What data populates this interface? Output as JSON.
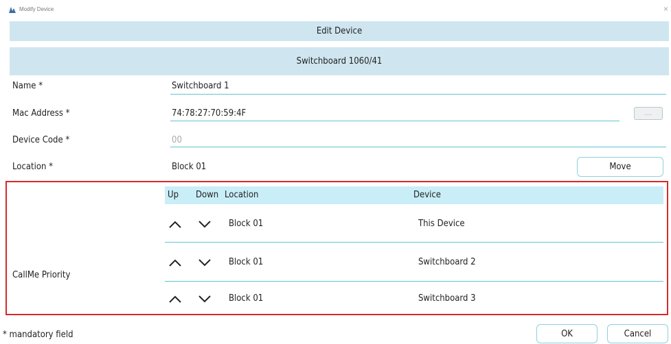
{
  "window": {
    "title": "Modify Device",
    "close_glyph": "×",
    "icon": "app-icon"
  },
  "header": {
    "title": "Edit Device"
  },
  "device": {
    "title": "Switchboard 1060/41"
  },
  "form": {
    "name_label": "Name *",
    "name_value": "Switchboard 1",
    "mac_label": "Mac Address *",
    "mac_value": "74:78:27:70:59:4F",
    "browse_label": "...",
    "code_label": "Device Code *",
    "code_placeholder": "00",
    "location_label": "Location *",
    "location_value": "Block 01",
    "move_label": "Move"
  },
  "priority": {
    "label": "CallMe Priority",
    "columns": {
      "up": "Up",
      "down": "Down",
      "location": "Location",
      "device": "Device"
    },
    "rows": [
      {
        "location": "Block 01",
        "device": "This Device"
      },
      {
        "location": "Block 01",
        "device": "Switchboard 2"
      },
      {
        "location": "Block 01",
        "device": "Switchboard 3"
      }
    ],
    "highlight_color": "#d62828"
  },
  "footer": {
    "note": "* mandatory field",
    "ok_label": "OK",
    "cancel_label": "Cancel"
  },
  "colors": {
    "accent": "#5ec4d4",
    "header_bg": "#cfe6f0",
    "table_header_bg": "#c9eef8"
  }
}
